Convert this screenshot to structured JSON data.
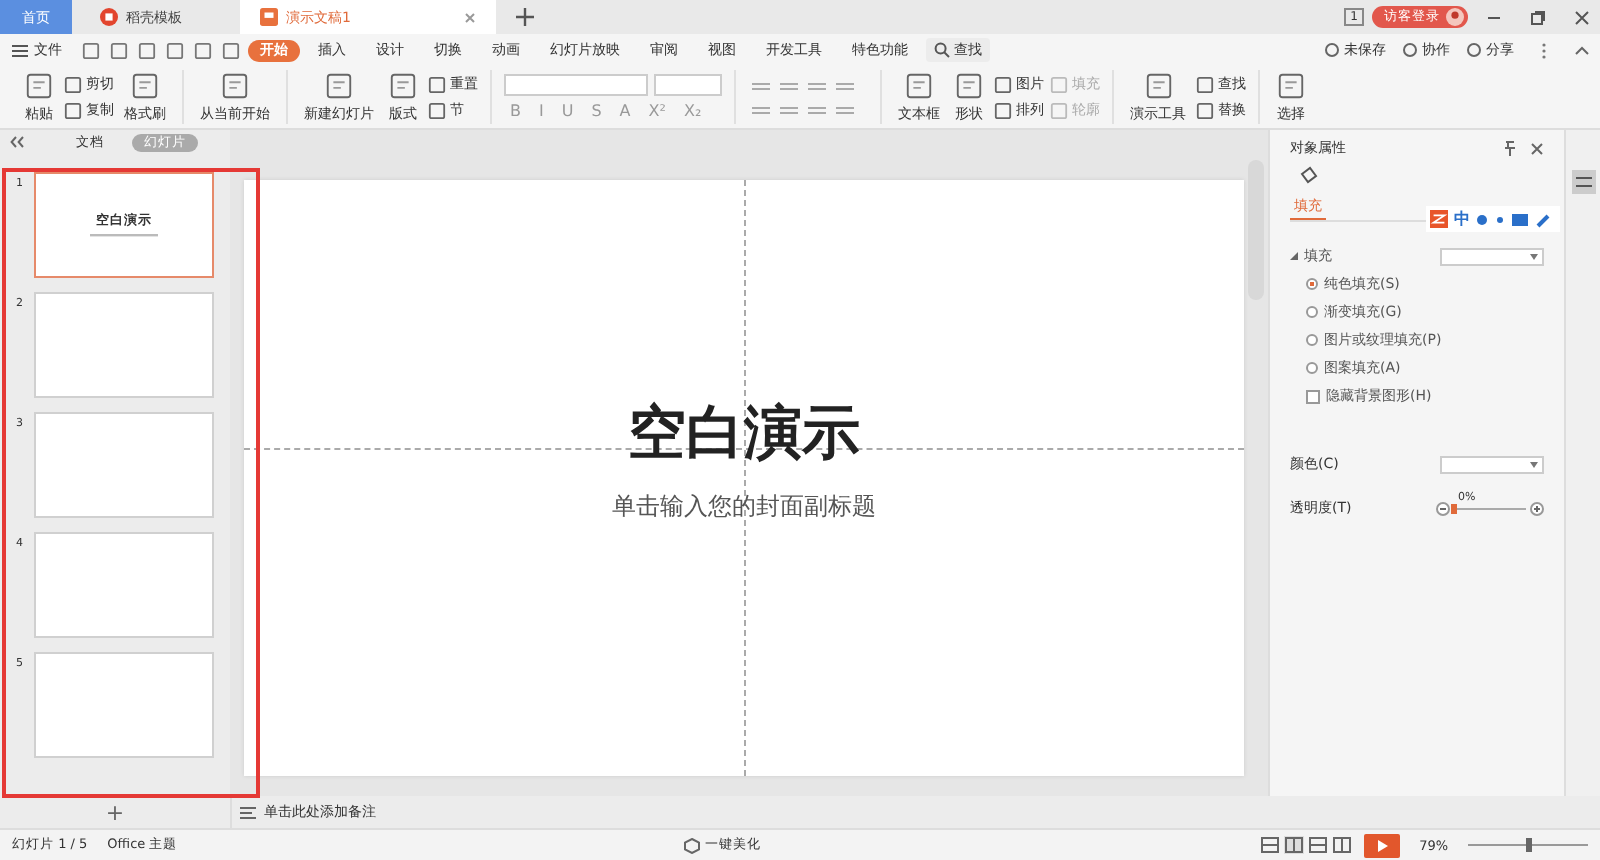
{
  "tabs": [
    {
      "label": "首页",
      "kind": "home",
      "selected": false
    },
    {
      "label": "稻壳模板",
      "kind": "template",
      "selected": false
    },
    {
      "label": "演示文稿1",
      "kind": "doc",
      "selected": true
    }
  ],
  "account": {
    "badge": "1",
    "login": "访客登录"
  },
  "menu": {
    "file": "文件",
    "tabs": [
      {
        "label": "开始",
        "selected": true
      },
      {
        "label": "插入",
        "selected": false
      },
      {
        "label": "设计",
        "selected": false
      },
      {
        "label": "切换",
        "selected": false
      },
      {
        "label": "动画",
        "selected": false
      },
      {
        "label": "幻灯片放映",
        "selected": false
      },
      {
        "label": "审阅",
        "selected": false
      },
      {
        "label": "视图",
        "selected": false
      },
      {
        "label": "开发工具",
        "selected": false
      },
      {
        "label": "特色功能",
        "selected": false
      }
    ],
    "search": "查找",
    "actions": [
      "未保存",
      "协作",
      "分享"
    ]
  },
  "ribbon": {
    "groups": [
      {
        "items": [
          {
            "kind": "big",
            "label": "粘贴",
            "disabled": false
          },
          {
            "kind": "stack",
            "items": [
              {
                "label": "剪切",
                "disabled": false
              },
              {
                "label": "复制",
                "disabled": false
              }
            ]
          },
          {
            "kind": "big",
            "label": "格式刷",
            "disabled": false
          }
        ]
      },
      {
        "items": [
          {
            "kind": "big",
            "label": "从当前开始",
            "disabled": false
          }
        ]
      },
      {
        "items": [
          {
            "kind": "big",
            "label": "新建幻灯片",
            "disabled": false
          },
          {
            "kind": "big",
            "label": "版式",
            "disabled": false
          },
          {
            "kind": "stack",
            "items": [
              {
                "label": "重置",
                "disabled": false
              },
              {
                "label": "节",
                "disabled": false
              }
            ]
          }
        ]
      },
      {
        "items": [
          {
            "kind": "font",
            "glyphs": [
              "B",
              "I",
              "U",
              "S",
              "A",
              "X²",
              "X₂"
            ]
          }
        ]
      },
      {
        "items": [
          {
            "kind": "paragraph"
          }
        ]
      },
      {
        "items": [
          {
            "kind": "big",
            "label": "文本框",
            "disabled": false
          },
          {
            "kind": "big",
            "label": "形状",
            "disabled": false
          },
          {
            "kind": "stack",
            "items": [
              {
                "label": "图片",
                "disabled": false
              },
              {
                "label": "排列",
                "disabled": false
              }
            ]
          },
          {
            "kind": "stack",
            "items": [
              {
                "label": "填充",
                "disabled": true
              },
              {
                "label": "轮廓",
                "disabled": true
              }
            ]
          }
        ]
      },
      {
        "items": [
          {
            "kind": "big",
            "label": "演示工具",
            "disabled": false
          },
          {
            "kind": "stack",
            "items": [
              {
                "label": "查找",
                "disabled": false
              },
              {
                "label": "替换",
                "disabled": false
              }
            ]
          }
        ]
      },
      {
        "items": [
          {
            "kind": "big",
            "label": "选择",
            "disabled": false
          }
        ]
      }
    ]
  },
  "panel": {
    "tabs": [
      {
        "label": "文档",
        "selected": false
      },
      {
        "label": "幻灯片",
        "selected": true
      }
    ],
    "thumbnails": [
      {
        "number": "1",
        "title": "空白演示",
        "selected": true
      },
      {
        "number": "2",
        "selected": false
      },
      {
        "number": "3",
        "selected": false
      },
      {
        "number": "4",
        "selected": false
      },
      {
        "number": "5",
        "selected": false
      }
    ]
  },
  "slide": {
    "title": "空白演示",
    "subtitle": "单击输入您的封面副标题"
  },
  "notes": {
    "add": "+",
    "placeholder": "单击此处添加备注"
  },
  "properties": {
    "title": "对象属性",
    "tabs": [
      {
        "label": "填充",
        "selected": true
      }
    ],
    "section": "填充",
    "options": [
      {
        "kind": "radio",
        "label": "纯色填充(S)",
        "selected": true
      },
      {
        "kind": "radio",
        "label": "渐变填充(G)",
        "selected": false
      },
      {
        "kind": "radio",
        "label": "图片或纹理填充(P)",
        "selected": false
      },
      {
        "kind": "radio",
        "label": "图案填充(A)",
        "selected": false
      },
      {
        "kind": "checkbox",
        "label": "隐藏背景图形(H)",
        "checked": false
      }
    ],
    "color_label": "颜色(C)",
    "transparency": {
      "label": "透明度(T)",
      "reading": "0%",
      "level": 0
    }
  },
  "ime": {
    "label": "中"
  },
  "status": {
    "slide": "幻灯片 1 / 5",
    "theme": "Office 主题",
    "beautify": "一键美化",
    "zoom": "79%",
    "zoom_level": {
      "level": 0.5
    }
  }
}
